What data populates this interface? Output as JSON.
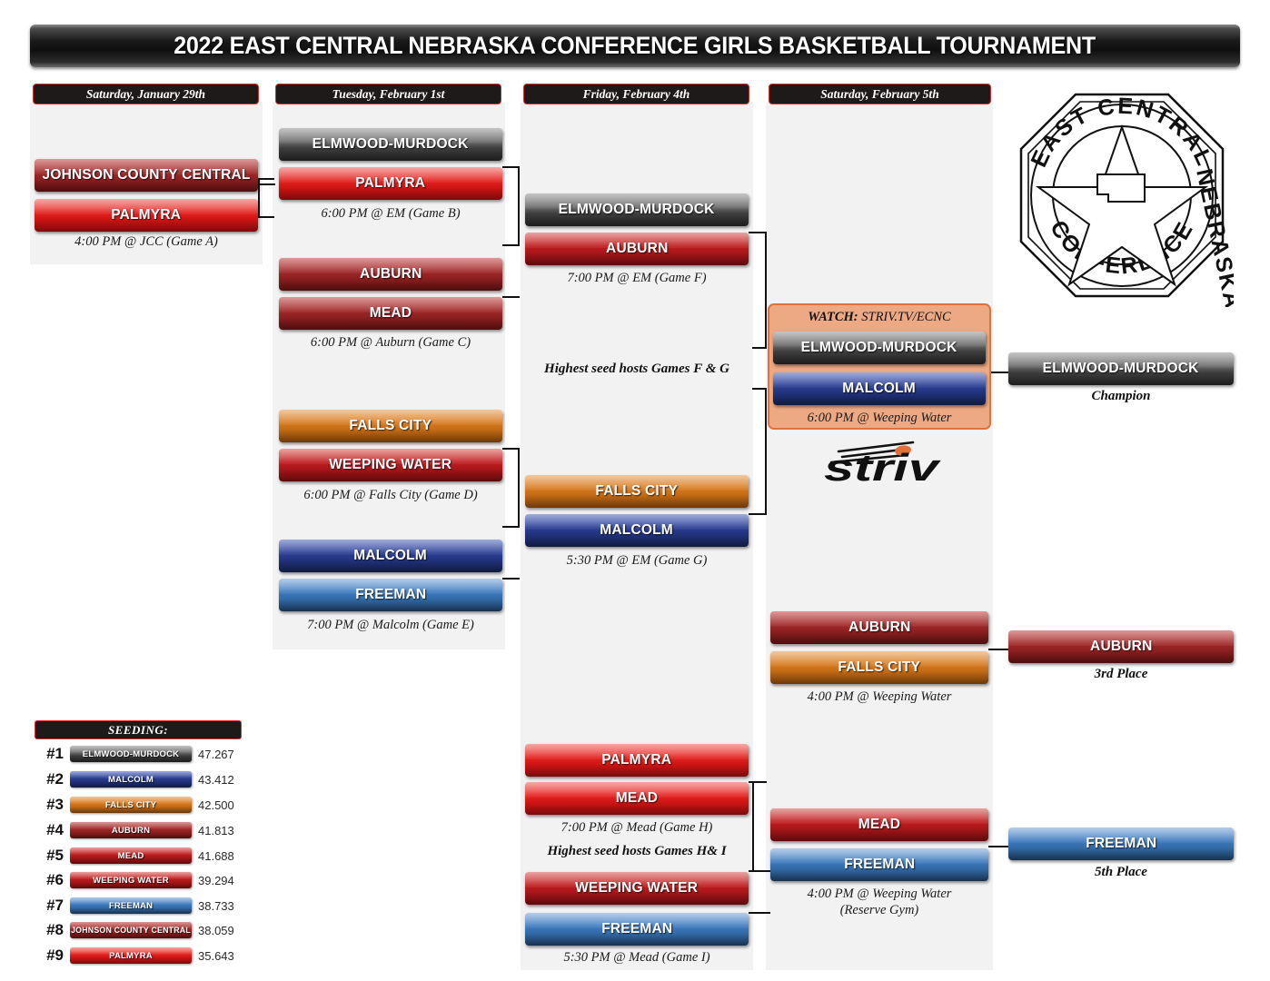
{
  "title": "2022 EAST CENTRAL NEBRASKA CONFERENCE GIRLS BASKETBALL TOURNAMENT",
  "columns": [
    {
      "name": "round-1",
      "date": "Saturday, January 29th"
    },
    {
      "name": "round-2",
      "date": "Tuesday, February 1st"
    },
    {
      "name": "round-3",
      "date": "Friday, February 4th"
    },
    {
      "name": "round-4",
      "date": "Saturday, February 5th"
    }
  ],
  "games": {
    "a": {
      "teams": [
        {
          "name": "JOHNSON COUNTY CENTRAL",
          "color": "darkred"
        },
        {
          "name": "PALMYRA",
          "color": "red"
        }
      ],
      "caption": "4:00 PM @ JCC (Game A)"
    },
    "b": {
      "teams": [
        {
          "name": "ELMWOOD-MURDOCK",
          "color": "gray"
        },
        {
          "name": "PALMYRA",
          "color": "red"
        }
      ],
      "caption": "6:00 PM @ EM (Game B)"
    },
    "c": {
      "teams": [
        {
          "name": "AUBURN",
          "color": "darkred"
        },
        {
          "name": "MEAD",
          "color": "darkred"
        }
      ],
      "caption": "6:00 PM @ Auburn (Game C)"
    },
    "d": {
      "teams": [
        {
          "name": "FALLS CITY",
          "color": "orange"
        },
        {
          "name": "WEEPING WATER",
          "color": "crimson"
        }
      ],
      "caption": "6:00 PM @ Falls City (Game D)"
    },
    "e": {
      "teams": [
        {
          "name": "MALCOLM",
          "color": "navy"
        },
        {
          "name": "FREEMAN",
          "color": "blue"
        }
      ],
      "caption": "7:00 PM @ Malcolm (Game E)"
    },
    "f": {
      "teams": [
        {
          "name": "ELMWOOD-MURDOCK",
          "color": "gray"
        },
        {
          "name": "AUBURN",
          "color": "crimson"
        }
      ],
      "caption": "7:00 PM @ EM (Game F)"
    },
    "g": {
      "teams": [
        {
          "name": "FALLS CITY",
          "color": "orange"
        },
        {
          "name": "MALCOLM",
          "color": "navy"
        }
      ],
      "caption": "5:30 PM @ EM (Game G)"
    },
    "h": {
      "teams": [
        {
          "name": "PALMYRA",
          "color": "red"
        },
        {
          "name": "MEAD",
          "color": "red"
        }
      ],
      "caption": "7:00 PM @ Mead (Game H)"
    },
    "i": {
      "teams": [
        {
          "name": "WEEPING WATER",
          "color": "crimson"
        },
        {
          "name": "FREEMAN",
          "color": "blue"
        }
      ],
      "caption": "5:30 PM @ Mead (Game I)"
    },
    "championship": {
      "watch_prefix": "WATCH:",
      "watch_url": "STRIV.TV/ECNC",
      "teams": [
        {
          "name": "ELMWOOD-MURDOCK",
          "color": "gray"
        },
        {
          "name": "MALCOLM",
          "color": "navy"
        }
      ],
      "caption": "6:00 PM @ Weeping Water"
    },
    "third_place": {
      "teams": [
        {
          "name": "AUBURN",
          "color": "darkred"
        },
        {
          "name": "FALLS CITY",
          "color": "orange"
        }
      ],
      "caption": "4:00 PM @ Weeping Water"
    },
    "fifth_place": {
      "teams": [
        {
          "name": "MEAD",
          "color": "crimson"
        },
        {
          "name": "FREEMAN",
          "color": "blue"
        }
      ],
      "caption_line1": "4:00 PM @ Weeping Water",
      "caption_line2": "(Reserve Gym)"
    }
  },
  "results": {
    "champion": {
      "name": "ELMWOOD-MURDOCK",
      "color": "gray",
      "label": "Champion"
    },
    "third": {
      "name": "AUBURN",
      "color": "darkred",
      "label": "3rd Place"
    },
    "fifth": {
      "name": "FREEMAN",
      "color": "blue",
      "label": "5th Place"
    }
  },
  "notes": {
    "fg": "Highest seed hosts Games F & G",
    "hi": "Highest seed hosts Games H& I"
  },
  "seeding": {
    "header": "SEEDING:",
    "rows": [
      {
        "seed": "#1",
        "team": "ELMWOOD-MURDOCK",
        "rating": "47.267",
        "color": "gray"
      },
      {
        "seed": "#2",
        "team": "MALCOLM",
        "rating": "43.412",
        "color": "navy"
      },
      {
        "seed": "#3",
        "team": "FALLS CITY",
        "rating": "42.500",
        "color": "orange"
      },
      {
        "seed": "#4",
        "team": "AUBURN",
        "rating": "41.813",
        "color": "darkred"
      },
      {
        "seed": "#5",
        "team": "MEAD",
        "rating": "41.688",
        "color": "crimson"
      },
      {
        "seed": "#6",
        "team": "WEEPING WATER",
        "rating": "39.294",
        "color": "crimson"
      },
      {
        "seed": "#7",
        "team": "FREEMAN",
        "rating": "38.733",
        "color": "blue"
      },
      {
        "seed": "#8",
        "team": "JOHNSON COUNTY CENTRAL",
        "rating": "38.059",
        "color": "darkred"
      },
      {
        "seed": "#9",
        "team": "PALMYRA",
        "rating": "35.643",
        "color": "red"
      }
    ]
  },
  "logos": {
    "conference": {
      "name": "ecnc-conference-seal",
      "text_top": "EAST CENTRAL",
      "text_bottom": "CONFERENCE",
      "text_right": "NEBRASKA"
    },
    "broadcast": {
      "name": "striv-logo",
      "text": "striv",
      "accent": "#e2703a"
    }
  },
  "colors": {
    "accent_red": "#d92b2b",
    "panel": "#f2f2f2",
    "champ_box_bg": "#eda984",
    "champ_box_border": "#e2703a"
  }
}
